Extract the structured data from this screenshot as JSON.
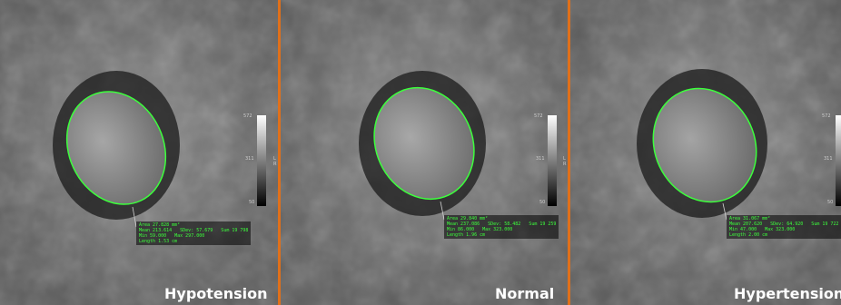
{
  "panels": [
    {
      "caption": "Hypotension",
      "measurement": {
        "area": "Area 27.828 mm²",
        "mean": "Mean 213.614   SDev: 57.679   Sum 19 798",
        "minmax": "Min 59.000   Max 297.000",
        "length": "Length 1.53 cm"
      },
      "scale": {
        "max": "572",
        "mid": "311",
        "min": "50"
      },
      "rl": "L R"
    },
    {
      "caption": "Normal",
      "measurement": {
        "area": "Area 29.840 mm²",
        "mean": "Mean 237.086   SDev: 58.482   Sum 19 259",
        "minmax": "Min 86.000   Max 323.000",
        "length": "Length 1.96 cm"
      },
      "scale": {
        "max": "572",
        "mid": "311",
        "min": "50"
      },
      "rl": "L R"
    },
    {
      "caption": "Hypertension",
      "measurement": {
        "area": "Area 31.067 mm²",
        "mean": "Mean 207.620   SDev: 64.920   Sum 19 722",
        "minmax": "Min 47.000   Max 323.000",
        "length": "Length 2.00 cm"
      },
      "scale": {
        "max": "572",
        "mid": "311",
        "min": "50"
      }
    }
  ],
  "colors": {
    "roi_outline": "#3cff3c",
    "divider_orange": "#e0701a",
    "divider_green": "#2fbf2f"
  }
}
